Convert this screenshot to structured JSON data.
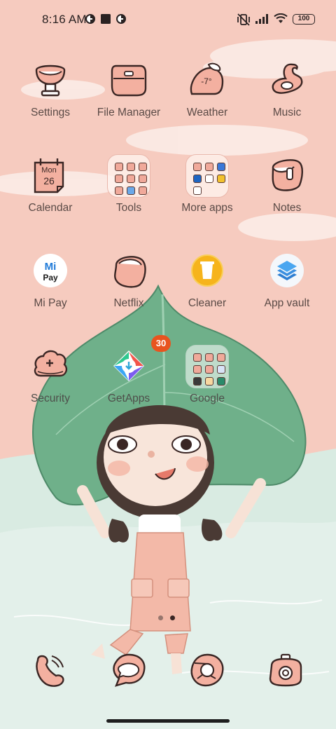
{
  "status_bar": {
    "time": "8:16 AM",
    "icons": [
      "notification-c-icon",
      "square-notification-icon",
      "notification-c-icon",
      "silent-mode-icon",
      "signal-icon",
      "wifi-icon"
    ],
    "battery_percent": "100"
  },
  "apps": [
    {
      "label": "Settings",
      "icon": "settings-icon"
    },
    {
      "label": "File Manager",
      "icon": "file-manager-icon"
    },
    {
      "label": "Weather",
      "icon": "weather-icon",
      "temperature": "-7°"
    },
    {
      "label": "Music",
      "icon": "music-icon"
    },
    {
      "label": "Calendar",
      "icon": "calendar-icon",
      "month": "Mon",
      "day": "26"
    },
    {
      "label": "Tools",
      "icon": "folder-icon"
    },
    {
      "label": "More apps",
      "icon": "folder-icon"
    },
    {
      "label": "Notes",
      "icon": "notes-icon"
    },
    {
      "label": "Mi Pay",
      "icon": "mi-pay-icon",
      "logo_top": "Mi",
      "logo_bottom": "Pay"
    },
    {
      "label": "Netflix",
      "icon": "netflix-icon"
    },
    {
      "label": "Cleaner",
      "icon": "cleaner-icon"
    },
    {
      "label": "App vault",
      "icon": "app-vault-icon"
    },
    {
      "label": "Security",
      "icon": "security-icon"
    },
    {
      "label": "GetApps",
      "icon": "getapps-icon",
      "badge": "30"
    },
    {
      "label": "Google",
      "icon": "folder-icon"
    }
  ],
  "dock": [
    {
      "name": "phone",
      "icon": "phone-icon"
    },
    {
      "name": "messages",
      "icon": "messages-icon"
    },
    {
      "name": "browser",
      "icon": "browser-icon"
    },
    {
      "name": "camera",
      "icon": "camera-icon"
    }
  ],
  "page_indicator": {
    "pages": 2,
    "current": 2
  },
  "colors": {
    "sky": "#f6cbbf",
    "ground": "#d9ebe2",
    "leaf": "#6fb08a",
    "icon_fill": "#f3b0a0",
    "icon_stroke": "#3a2624",
    "badge": "#e8541f",
    "label_text": "#5a4a46"
  }
}
